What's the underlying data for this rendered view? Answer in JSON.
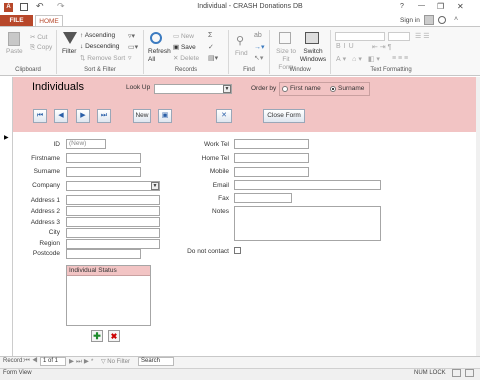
{
  "window": {
    "title": "Individual - CRASH Donations DB",
    "signin": "Sign in",
    "controls": [
      "?",
      "—",
      "❐",
      "✕"
    ]
  },
  "tabs": {
    "file": "FILE",
    "home": "HOME"
  },
  "ribbon": {
    "clipboard": {
      "paste": "Paste",
      "cut": "Cut",
      "copy": "Copy",
      "label": "Clipboard"
    },
    "sort": {
      "filter": "Filter",
      "ascending": "Ascending",
      "descending": "Descending",
      "remove": "Remove Sort",
      "label": "Sort & Filter"
    },
    "records": {
      "refresh": "Refresh All",
      "new": "New",
      "save": "Save",
      "delete": "Delete",
      "label": "Records"
    },
    "find": {
      "find": "Find",
      "label": "Find"
    },
    "window": {
      "size": "Size to Fit Form",
      "switch": "Switch Windows",
      "label": "Window"
    },
    "text": {
      "label": "Text Formatting"
    }
  },
  "header": {
    "title": "Individuals",
    "lookup": "Look Up",
    "orderby": "Order by",
    "first": "First name",
    "surname": "Surname",
    "new_btn": "New",
    "close_btn": "Close Form"
  },
  "fields": {
    "id": "ID",
    "id_value": "(New)",
    "firstname": "Firstname",
    "surname": "Surname",
    "company": "Company",
    "address1": "Address 1",
    "address2": "Address 2",
    "address3": "Address 3",
    "city": "City",
    "region": "Region",
    "postcode": "Postcode",
    "worktel": "Work Tel",
    "hometel": "Home Tel",
    "mobile": "Mobile",
    "email": "Email",
    "fax": "Fax",
    "notes": "Notes",
    "donotcontact": "Do not contact"
  },
  "status_list": {
    "header": "Individual Status"
  },
  "recordbar": {
    "record": "Record:",
    "pos": "1 of 1",
    "nofilter": "No Filter",
    "search": "Search"
  },
  "statusbar": {
    "view": "Form View",
    "numlock": "NUM LOCK"
  }
}
